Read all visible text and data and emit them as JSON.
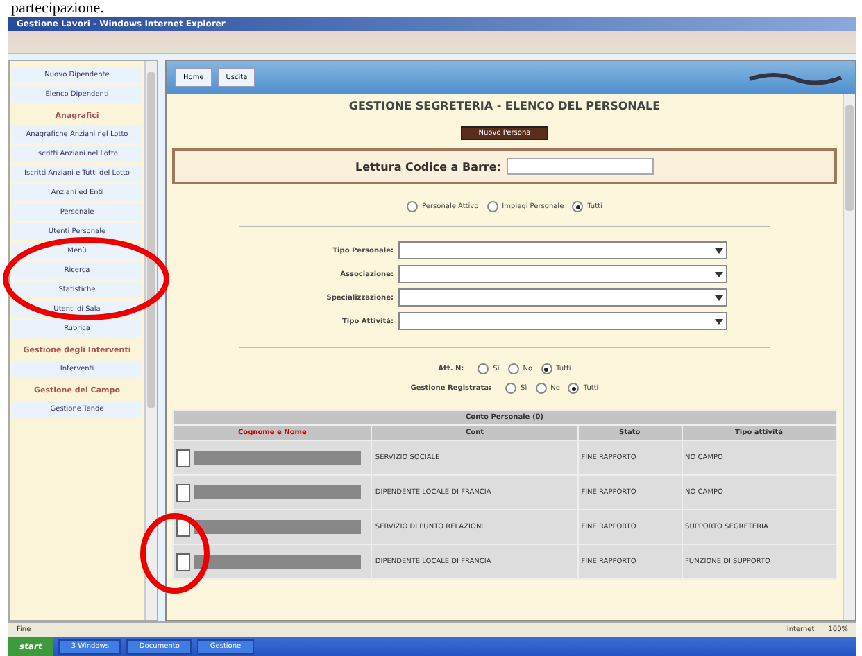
{
  "caption": "partecipazione.",
  "window": {
    "title": "Gestione Lavori - Windows Internet Explorer"
  },
  "sidebar": {
    "items": [
      {
        "kind": "link",
        "label": "Nuovo Dipendente"
      },
      {
        "kind": "link",
        "label": "Elenco Dipendenti"
      },
      {
        "kind": "header",
        "label": "Anagrafici"
      },
      {
        "kind": "link",
        "label": "Anagrafiche Anziani nel Lotto"
      },
      {
        "kind": "link",
        "label": "Iscritti Anziani nel Lotto"
      },
      {
        "kind": "link",
        "label": "Iscritti Anziani e Tutti del Lotto"
      },
      {
        "kind": "link",
        "label": "Anziani ed Enti"
      },
      {
        "kind": "link",
        "label": "Personale"
      },
      {
        "kind": "link",
        "label": "Utenti Personale"
      },
      {
        "kind": "link",
        "label": "Menù"
      },
      {
        "kind": "link",
        "label": "Ricerca"
      },
      {
        "kind": "link",
        "label": "Statistiche"
      },
      {
        "kind": "link",
        "label": "Utenti di Sala"
      },
      {
        "kind": "link",
        "label": "Rubrica"
      },
      {
        "kind": "header",
        "label": "Gestione degli Interventi"
      },
      {
        "kind": "link",
        "label": "Interventi"
      },
      {
        "kind": "header",
        "label": "Gestione del Campo"
      },
      {
        "kind": "link",
        "label": "Gestione Tende"
      }
    ]
  },
  "header": {
    "buttons": [
      "Home",
      "Uscita"
    ]
  },
  "page": {
    "title": "GESTIONE SEGRETERIA - ELENCO DEL PERSONALE",
    "new_button": "Nuovo Persona",
    "barcode": {
      "label": "Lettura Codice a Barre:"
    },
    "filter_radios": [
      {
        "label": "Personale Attivo",
        "selected": false
      },
      {
        "label": "Impiegi Personale",
        "selected": false
      },
      {
        "label": "Tutti",
        "selected": true
      }
    ],
    "selects": [
      {
        "label": "Tipo Personale:"
      },
      {
        "label": "Associazione:"
      },
      {
        "label": "Specializzazione:"
      },
      {
        "label": "Tipo Attività:"
      }
    ],
    "radio_groups": [
      {
        "label": "Att. N:",
        "options": [
          {
            "label": "Sì",
            "selected": false
          },
          {
            "label": "No",
            "selected": false
          },
          {
            "label": "Tutti",
            "selected": true
          }
        ]
      },
      {
        "label": "Gestione Registrata:",
        "options": [
          {
            "label": "Sì",
            "selected": false
          },
          {
            "label": "No",
            "selected": false
          },
          {
            "label": "Tutti",
            "selected": true
          }
        ]
      }
    ]
  },
  "table": {
    "group_heading": "Conto Personale (0)",
    "columns": [
      "Cognome e Nome",
      "Cont",
      "Stato",
      "Tipo attività"
    ],
    "rows": [
      {
        "column_2": "SERVIZIO SOCIALE",
        "stato": "FINE RAPPORTO",
        "tipo": "NO CAMPO"
      },
      {
        "column_2": "DIPENDENTE LOCALE DI FRANCIA",
        "stato": "FINE RAPPORTO",
        "tipo": "NO CAMPO"
      },
      {
        "column_2": "SERVIZIO DI PUNTO RELAZIONI",
        "stato": "FINE RAPPORTO",
        "tipo": "SUPPORTO SEGRETERIA"
      },
      {
        "column_2": "DIPENDENTE LOCALE DI FRANCIA",
        "stato": "FINE RAPPORTO",
        "tipo": "FUNZIONE DI SUPPORTO"
      }
    ]
  },
  "status_bar": {
    "left": "Fine",
    "zone": "Internet",
    "zoom": "100%"
  },
  "taskbar": {
    "start": "start",
    "tasks": [
      "3 Windows",
      "Documento",
      "Gestione"
    ]
  }
}
